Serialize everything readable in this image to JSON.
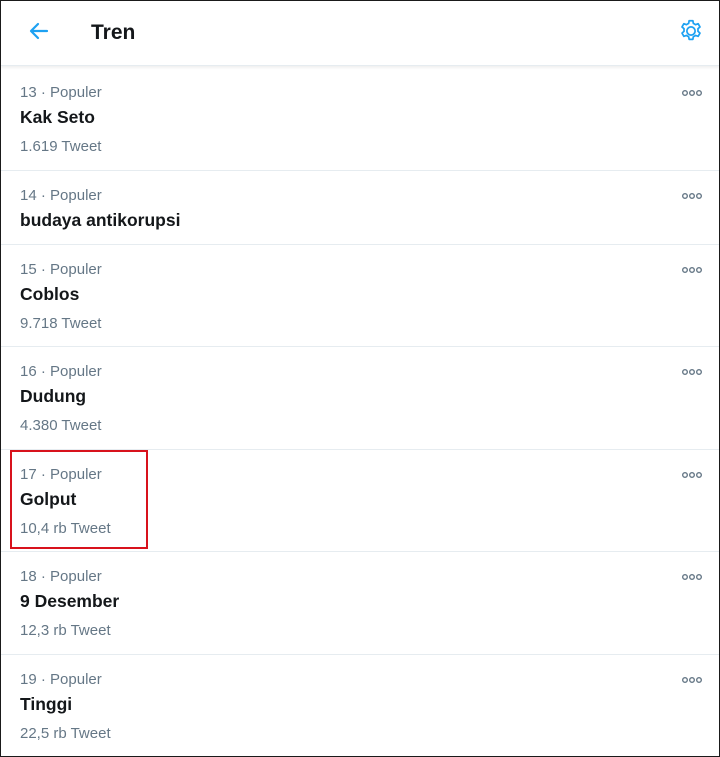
{
  "header": {
    "title": "Tren",
    "back_icon": "arrow-left-icon",
    "settings_icon": "gear-icon",
    "accent_color": "#1da1f2"
  },
  "trends": [
    {
      "rank": "13",
      "category": "Populer",
      "name": "Kak Seto",
      "count": "1.619 Tweet"
    },
    {
      "rank": "14",
      "category": "Populer",
      "name": "budaya antikorupsi",
      "count": ""
    },
    {
      "rank": "15",
      "category": "Populer",
      "name": "Coblos",
      "count": "9.718 Tweet"
    },
    {
      "rank": "16",
      "category": "Populer",
      "name": "Dudung",
      "count": "4.380 Tweet"
    },
    {
      "rank": "17",
      "category": "Populer",
      "name": "Golput",
      "count": "10,4 rb Tweet"
    },
    {
      "rank": "18",
      "category": "Populer",
      "name": "9 Desember",
      "count": "12,3 rb Tweet"
    },
    {
      "rank": "19",
      "category": "Populer",
      "name": "Tinggi",
      "count": "22,5 rb Tweet"
    }
  ],
  "more_icon": "more-horizontal-icon",
  "highlight": {
    "color": "#d8121c",
    "trend_rank": "17"
  }
}
